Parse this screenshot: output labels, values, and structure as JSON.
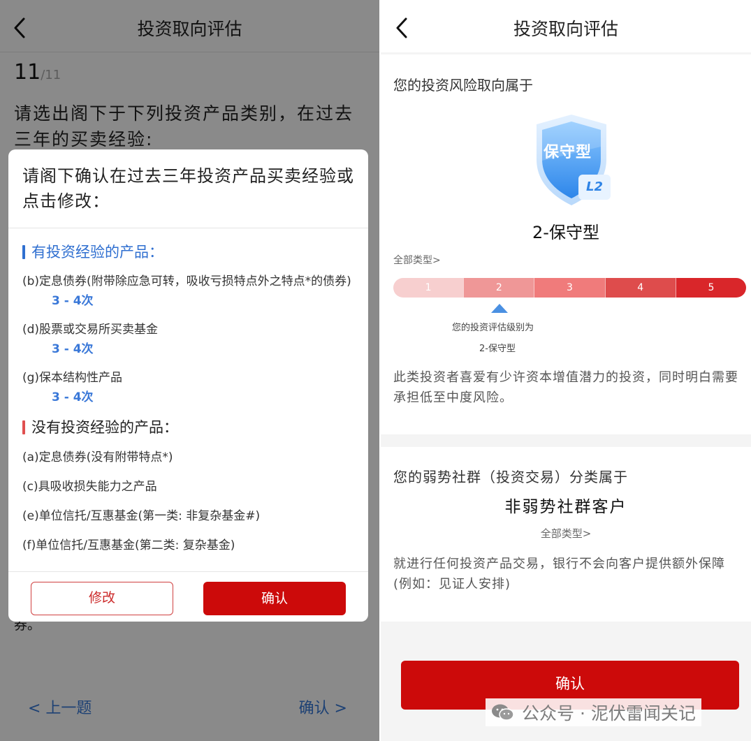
{
  "left": {
    "header": {
      "title": "投资取向评估"
    },
    "question": {
      "number": "11",
      "total": "/11",
      "text": "请选出阁下于下列投资产品类别，在过去三年的买卖经验:"
    },
    "background_tail": "券。",
    "nav": {
      "prev": "< 上一题",
      "next": "确认 >"
    },
    "modal": {
      "title": "请阁下确认在过去三年投资产品买卖经验或点击修改：",
      "experienced_title": "有投资经验的产品：",
      "experienced_items": [
        {
          "label": "(b)定息债券(附带除应急可转，吸收亏损特点外之特点*的债券)",
          "freq": "3 - 4次"
        },
        {
          "label": "(d)股票或交易所买卖基金",
          "freq": "3 - 4次"
        },
        {
          "label": "(g)保本结构性产品",
          "freq": "3 - 4次"
        }
      ],
      "no_experience_title": "没有投资经验的产品：",
      "no_experience_items": [
        "(a)定息债券(没有附带特点*)",
        "(c)具吸收损失能力之产品",
        "(e)单位信托/互惠基金(第一类: 非复杂基金#)",
        "(f)单位信托/互惠基金(第二类: 复杂基金)"
      ],
      "modify_label": "修改",
      "confirm_label": "确认"
    }
  },
  "right": {
    "header": {
      "title": "投资取向评估"
    },
    "risk_label": "您的投资风险取向属于",
    "badge_text": "保守型",
    "badge_level": "L2",
    "risk_type": "2-保守型",
    "all_types": "全部类型>",
    "levels": [
      "1",
      "2",
      "3",
      "4",
      "5"
    ],
    "level_colors": [
      "#f7cfcf",
      "#ef9797",
      "#f07b7b",
      "#de4c4c",
      "#d9262a"
    ],
    "current_level": 2,
    "level_label": "您的投资评估级别为",
    "level_value": "2-保守型",
    "risk_desc": "此类投资者喜爱有少许资本增值潜力的投资，同时明白需要承担低至中度风险。",
    "vuln_label": "您的弱势社群（投资交易）分类属于",
    "vuln_value": "非弱势社群客户",
    "vuln_all_types": "全部类型>",
    "vuln_desc": "就进行任何投资产品交易，银行不会向客户提供额外保障(例如：见证人安排)",
    "confirm_label": "确认",
    "watermark": "公众号 · 泥伏雷闻关记",
    "accent": "#cc0a0a"
  }
}
